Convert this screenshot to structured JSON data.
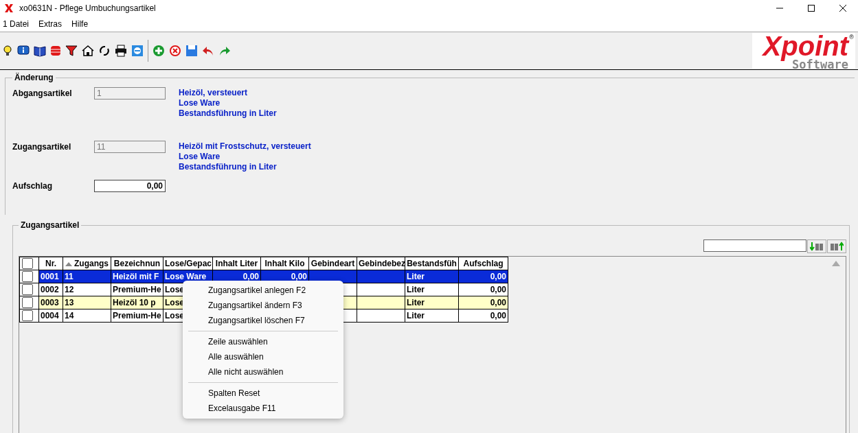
{
  "window": {
    "title": "xo0631N - Pflege Umbuchungsartikel"
  },
  "menu": [
    "1 Datei",
    "Extras",
    "Hilfe"
  ],
  "logo": {
    "brand": "Xpoint",
    "sub": "Software",
    "mark": "®"
  },
  "change_group": {
    "legend": "Änderung",
    "fields": [
      {
        "label": "Abgangsartikel",
        "value": "1",
        "editable": false,
        "info": [
          "Heizöl, versteuert",
          "Lose Ware",
          "Bestandsführung in Liter"
        ]
      },
      {
        "label": "Zugangsartikel",
        "value": "11",
        "editable": false,
        "info": [
          "Heizöl mit Frostschutz, versteuert",
          "Lose Ware",
          "Bestandsführung in Liter"
        ]
      },
      {
        "label": "Aufschlag",
        "value": "0,00",
        "editable": true
      }
    ]
  },
  "list_group": {
    "legend": "Zugangsartikel",
    "table": {
      "select_all_checked": false,
      "columns": [
        {
          "label": "Nr.",
          "sorted": false
        },
        {
          "label": "Zugangs",
          "sorted": true
        },
        {
          "label": "Bezeichnun",
          "sorted": false
        },
        {
          "label": "Lose/Gepac",
          "sorted": false
        },
        {
          "label": "Inhalt Liter",
          "sorted": false
        },
        {
          "label": "Inhalt Kilo",
          "sorted": false
        },
        {
          "label": "Gebindeart",
          "sorted": false
        },
        {
          "label": "Gebindebez",
          "sorted": false
        },
        {
          "label": "Bestandsfüh",
          "sorted": false
        },
        {
          "label": "Aufschlag",
          "sorted": false
        }
      ],
      "rows": [
        {
          "checked": false,
          "selected": true,
          "highlighted": false,
          "cells": [
            "0001",
            "11",
            "Heizöl mit F",
            "Lose Ware",
            "0,00",
            "0,00",
            null,
            null,
            "Liter",
            "0,00"
          ]
        },
        {
          "checked": false,
          "selected": false,
          "highlighted": false,
          "cells": [
            "0002",
            "12",
            "Premium-He",
            "Lose",
            null,
            null,
            null,
            null,
            "Liter",
            "0,00"
          ]
        },
        {
          "checked": false,
          "selected": false,
          "highlighted": true,
          "cells": [
            "0003",
            "13",
            "Heizöl 10 p",
            "Lose",
            null,
            null,
            null,
            null,
            "Liter",
            "0,00"
          ]
        },
        {
          "checked": false,
          "selected": false,
          "highlighted": false,
          "cells": [
            "0004",
            "14",
            "Premium-He",
            "Lose",
            null,
            null,
            null,
            null,
            "Liter",
            "0,00"
          ]
        }
      ]
    }
  },
  "context_menu": {
    "sections": [
      [
        "Zugangsartikel anlegen F2",
        "Zugangsartikel ändern F3",
        "Zugangsartikel löschen F7"
      ],
      [
        "Zeile auswählen",
        "Alle auswählen",
        "Alle nicht auswählen"
      ],
      [
        "Spalten Reset",
        "Excelausgabe F11"
      ]
    ]
  }
}
